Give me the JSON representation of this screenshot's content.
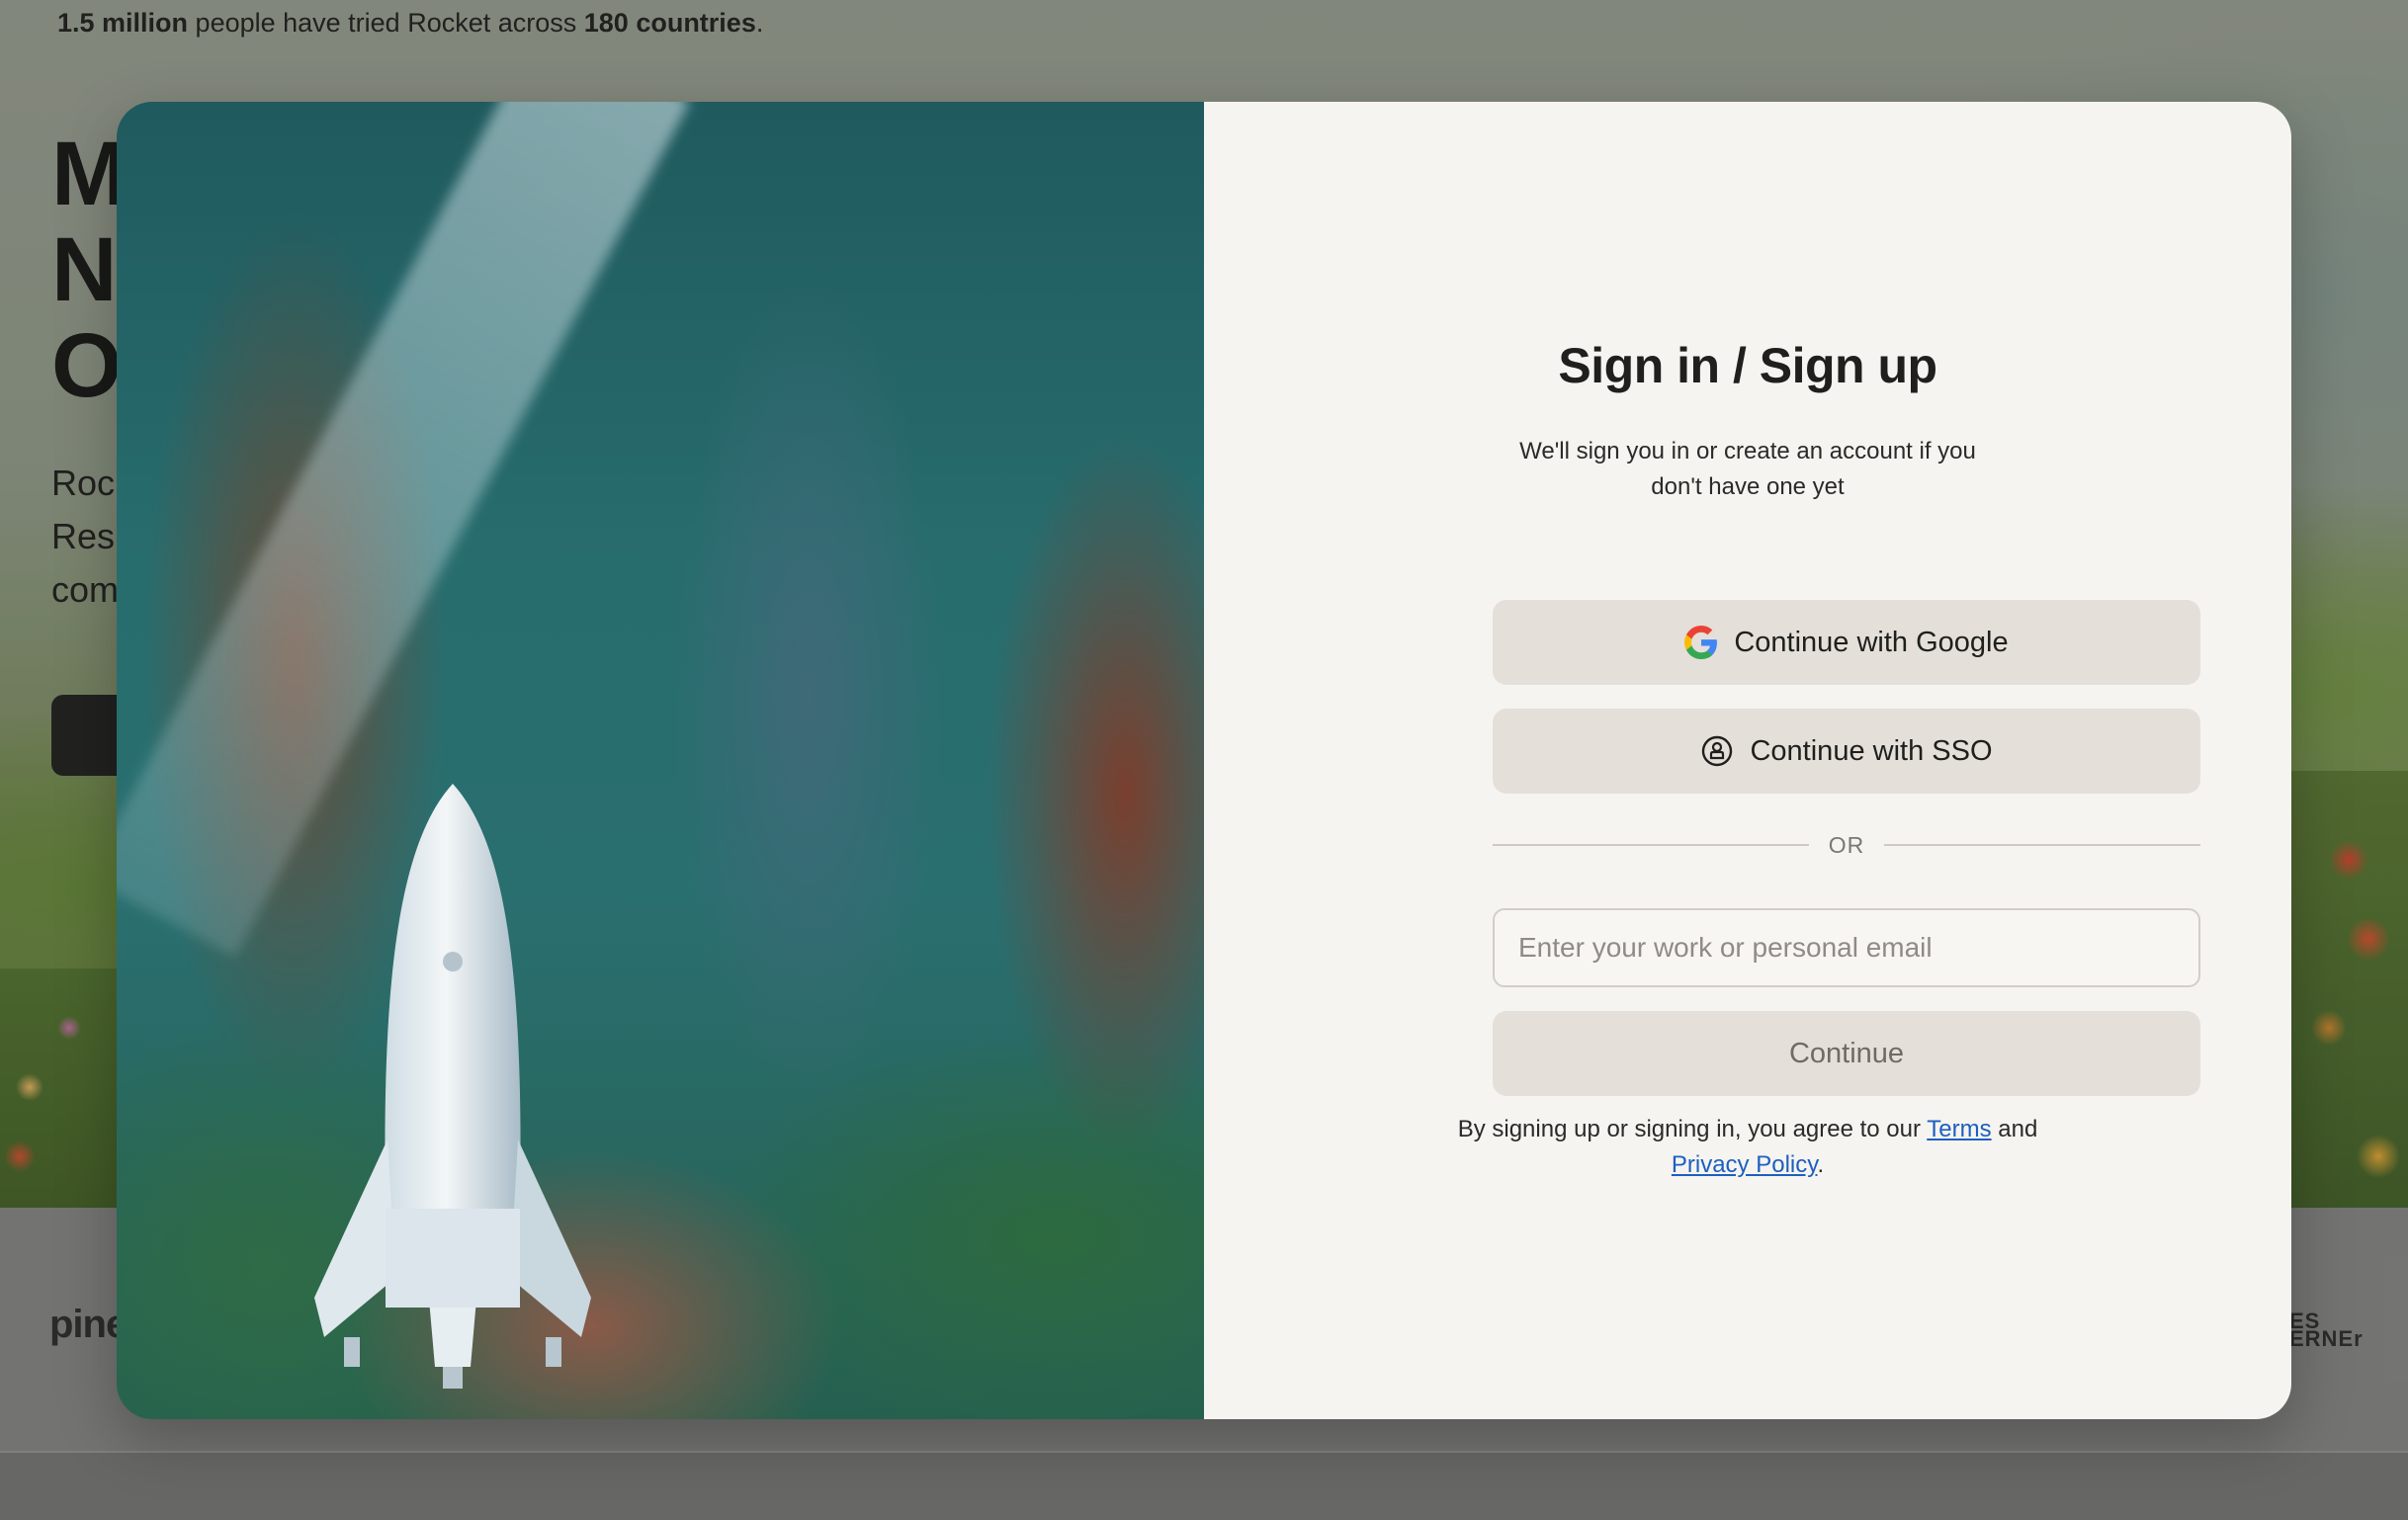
{
  "background": {
    "stats": {
      "count": "1.5 million",
      "text_mid": " people have tried Rocket across ",
      "countries": "180 countries",
      "text_end": "."
    },
    "headline_fragments": [
      "M",
      "N",
      "O"
    ],
    "subtext_fragments": [
      "Roc",
      "Res",
      "com"
    ],
    "logo_left": "pine",
    "logo_right_lines": [
      "ES",
      "ERNEr"
    ]
  },
  "modal": {
    "title": "Sign in / Sign up",
    "description": "We'll sign you in or create an account if you don't have one yet",
    "google_button_label": "Continue with Google",
    "sso_button_label": "Continue with SSO",
    "divider_label": "OR",
    "email_placeholder": "Enter your work or personal email",
    "email_value": "",
    "continue_button_label": "Continue",
    "legal": {
      "prefix": "By signing up or signing in, you agree to our ",
      "terms_link": "Terms",
      "middle": " and ",
      "privacy_link": "Privacy Policy",
      "suffix": "."
    },
    "icons": {
      "close": "close-icon",
      "google": "google-icon",
      "sso": "sso-key-icon",
      "image": "rocket-in-forest-illustration"
    }
  },
  "colors": {
    "panel_background": "#f5f4f0",
    "button_background": "#e4dfd9",
    "link": "#1d5fbf",
    "text": "#1f1f1d"
  }
}
